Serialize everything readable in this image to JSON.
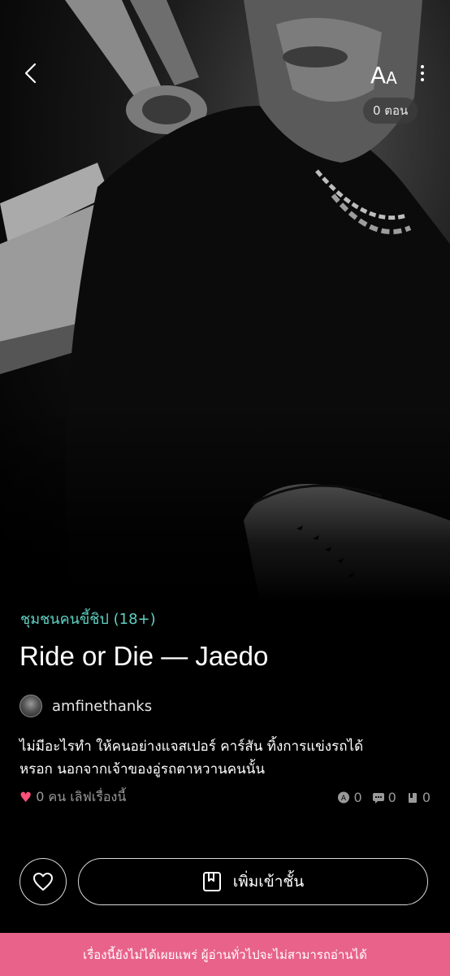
{
  "header": {
    "back_icon": "chevron-left-icon",
    "font_size_label_big": "A",
    "font_size_label_small": "A",
    "more_icon": "more-vertical-icon",
    "episode_count": "0 ตอน"
  },
  "story": {
    "category": "ชุมชนคนขี้ชิป (18+)",
    "title": "Ride or Die — Jaedo",
    "author": "amfinethanks",
    "synopsis_line1": "ไม่มีอะไรทำ ให้คนอย่างแจสเปอร์ คาร์สัน ทิ้งการแข่งรถได้",
    "synopsis_line2": "หรอก นอกจากเจ้าของอู่รถตาหวานคนนั้น",
    "love_text": "0 คน เลิฟเรื่องนี้",
    "stats": {
      "reviews": "0",
      "comments": "0",
      "shelves": "0"
    }
  },
  "actions": {
    "add_shelf_label": "เพิ่มเข้าชั้น"
  },
  "banner": {
    "text": "เรื่องนี้ยังไม่ได้เผยแพร่ ผู้อ่านทั่วไปจะไม่สามารถอ่านได้"
  },
  "colors": {
    "accent_teal": "#5fd0c2",
    "heart_pink": "#ff4f7b",
    "banner_pink": "#e8628a",
    "background": "#000000"
  }
}
